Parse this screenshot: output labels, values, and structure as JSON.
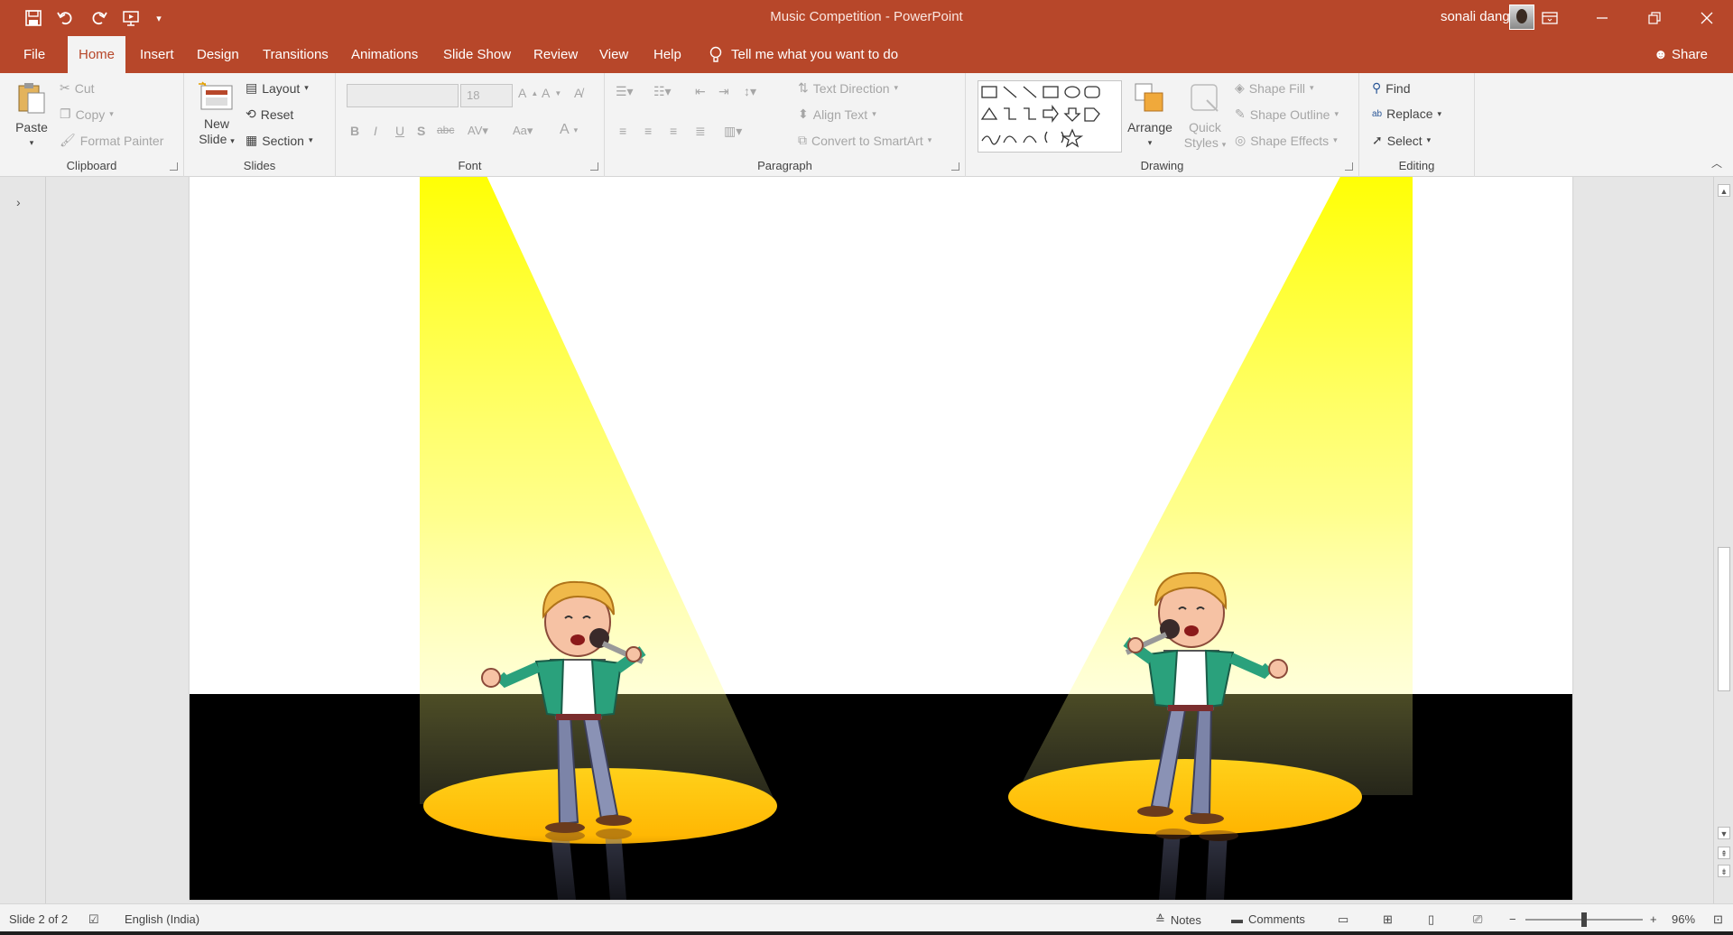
{
  "window": {
    "doc_title": "Music Competition",
    "app_name": "PowerPoint",
    "title_separator": " - ",
    "user_name": "sonali dangi",
    "accent": "#b7472a"
  },
  "tabs": [
    {
      "label": "File"
    },
    {
      "label": "Home",
      "active": true
    },
    {
      "label": "Insert"
    },
    {
      "label": "Design"
    },
    {
      "label": "Transitions"
    },
    {
      "label": "Animations"
    },
    {
      "label": "Slide Show"
    },
    {
      "label": "Review"
    },
    {
      "label": "View"
    },
    {
      "label": "Help"
    }
  ],
  "tellme": "Tell me what you want to do",
  "share": "Share",
  "clipboard": {
    "group": "Clipboard",
    "paste": "Paste",
    "cut": "Cut",
    "copy": "Copy",
    "format_painter": "Format Painter"
  },
  "slides_group": {
    "group": "Slides",
    "new_slide_1": "New",
    "new_slide_2": "Slide",
    "layout": "Layout",
    "reset": "Reset",
    "section": "Section"
  },
  "font": {
    "group": "Font",
    "font_name": "",
    "font_size": "18"
  },
  "paragraph": {
    "group": "Paragraph",
    "text_direction": "Text Direction",
    "align_text": "Align Text",
    "convert_smartart": "Convert to SmartArt"
  },
  "drawing": {
    "group": "Drawing",
    "arrange": "Arrange",
    "quick_styles_1": "Quick",
    "quick_styles_2": "Styles",
    "shape_fill": "Shape Fill",
    "shape_outline": "Shape Outline",
    "shape_effects": "Shape Effects"
  },
  "editing": {
    "group": "Editing",
    "find": "Find",
    "replace": "Replace",
    "select": "Select"
  },
  "status": {
    "slide_info": "Slide 2 of 2",
    "language": "English (India)",
    "notes": "Notes",
    "comments": "Comments",
    "zoom": "96%"
  },
  "slide": {
    "stage_color": "#000000",
    "spot_color": "#ffc000",
    "beam_color": "#ffff00"
  }
}
